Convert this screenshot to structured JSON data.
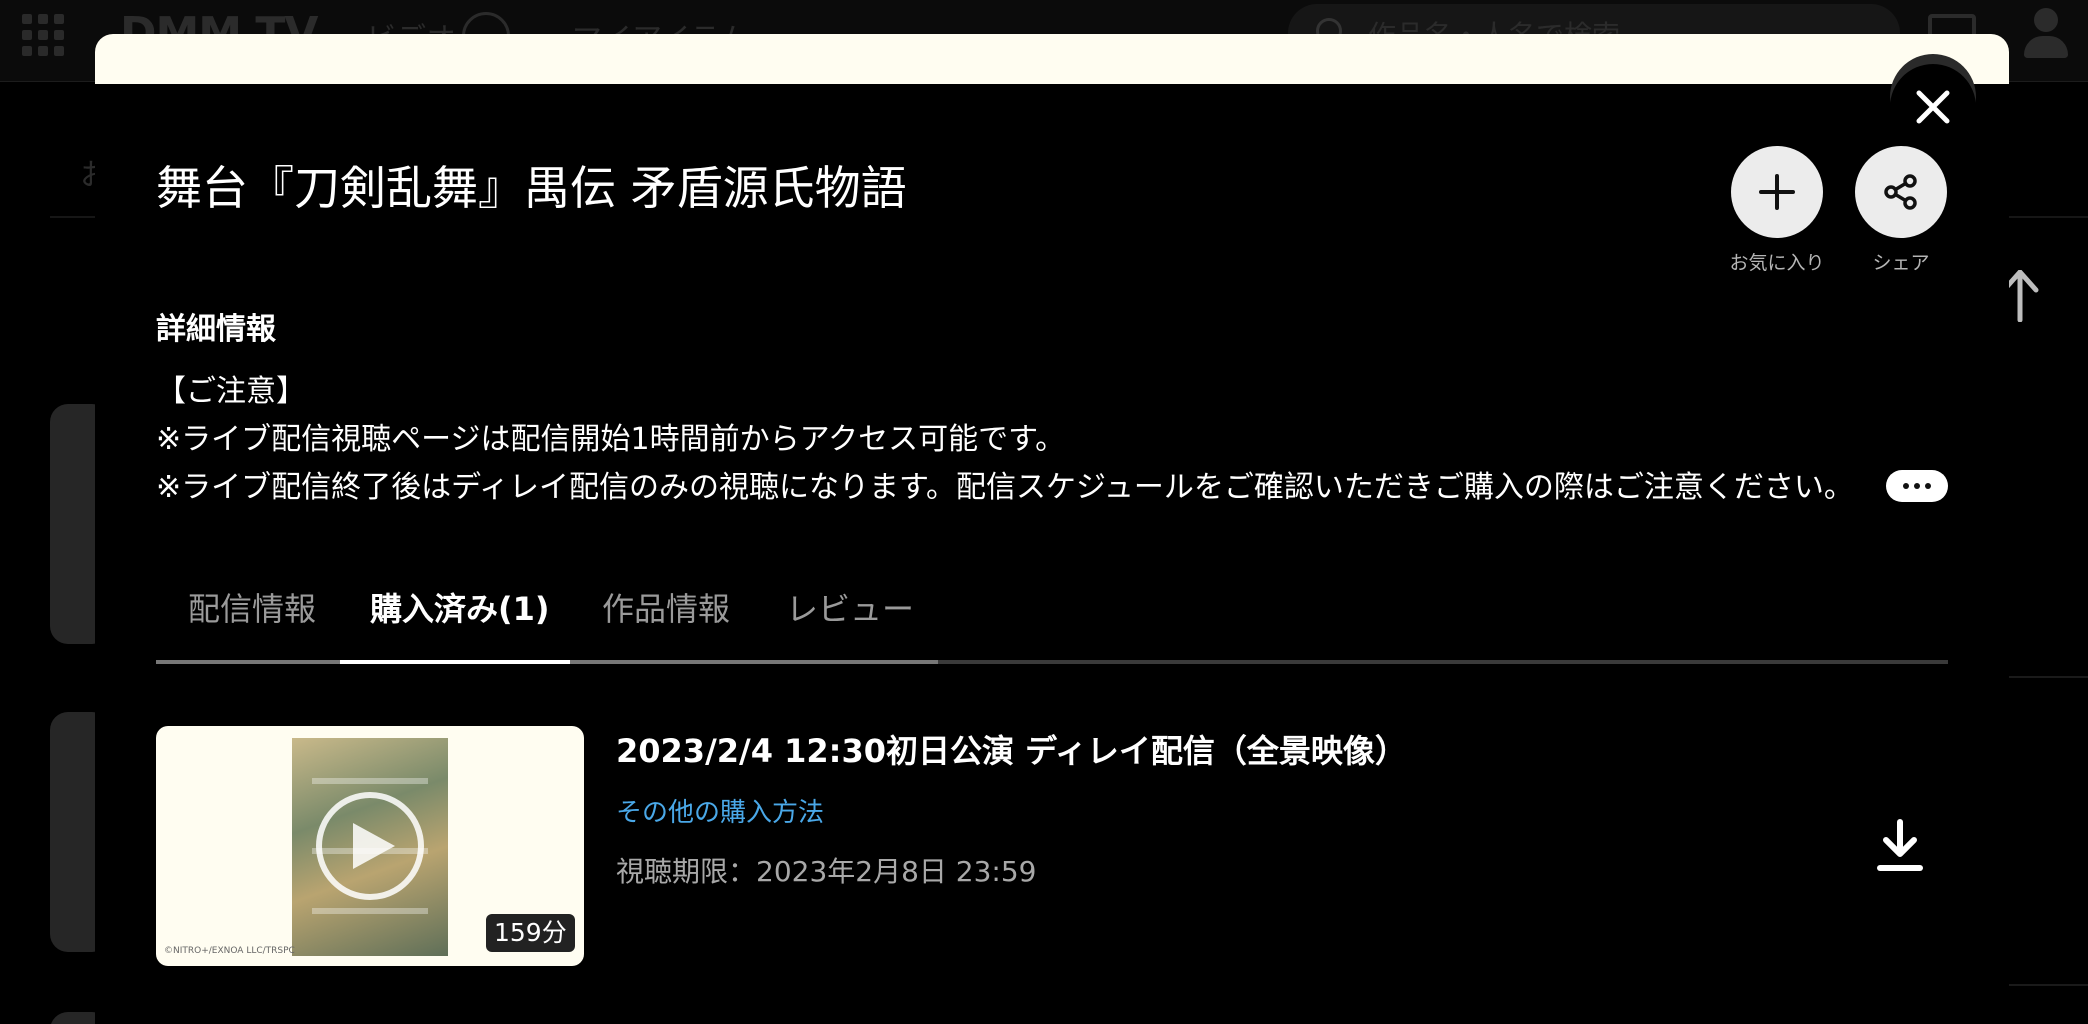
{
  "background": {
    "logo": "DMM TV",
    "nav_video": "ビデオ",
    "nav_myitem": "マイアイテム",
    "search_placeholder": "作品名・人名で検索",
    "tab_text": "お"
  },
  "modal": {
    "title": "舞台『刀剣乱舞』禺伝 矛盾源氏物語",
    "actions": {
      "favorite_label": "お気に入り",
      "share_label": "シェア"
    },
    "detail_heading": "詳細情報",
    "notice_lines": [
      "【ご注意】",
      "※ライブ配信視聴ページは配信開始1時間前からアクセス可能です。",
      "※ライブ配信終了後はディレイ配信のみの視聴になります。配信スケジュールをご確認いただきご購入の際はご注意ください。"
    ],
    "tabs": [
      {
        "label": "配信情報",
        "active": false
      },
      {
        "label": "購入済み(1)",
        "active": true
      },
      {
        "label": "作品情報",
        "active": false
      },
      {
        "label": "レビュー",
        "active": false
      }
    ],
    "purchased_item": {
      "title": "2023/2/4 12:30初日公演 ディレイ配信（全景映像）",
      "other_purchase_link": "その他の購入方法",
      "expiry": "視聴期限：2023年2月8日 23:59",
      "duration": "159分",
      "copyright": "©NITRO+/EXNOA LLC/TRSPC"
    }
  },
  "colors": {
    "modal_header_band": "#fffdf1",
    "link": "#4aa8e8",
    "action_circle": "#ececec",
    "tab_inactive": "#9a9a9a"
  },
  "icons": {
    "close": "close-icon",
    "favorite": "plus-icon",
    "share": "share-icon",
    "more": "ellipsis-icon",
    "play": "play-icon",
    "download": "download-icon"
  }
}
